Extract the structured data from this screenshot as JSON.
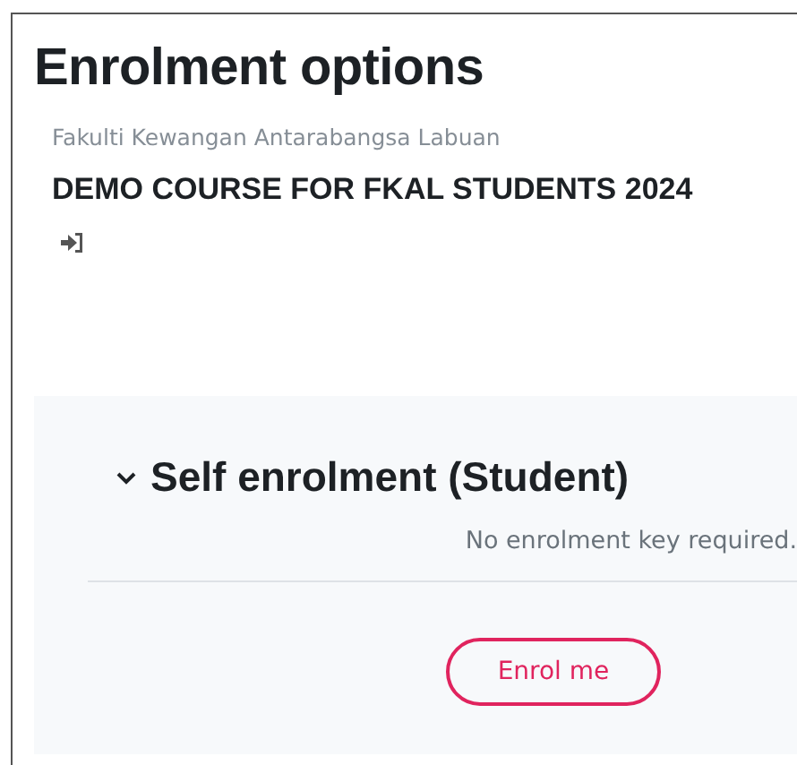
{
  "page": {
    "title": "Enrolment options"
  },
  "course": {
    "category": "Fakulti Kewangan Antarabangsa Labuan",
    "name": "DEMO COURSE FOR FKAL STUDENTS 2024"
  },
  "enrolment_method": {
    "title": "Self enrolment (Student)",
    "expanded": true,
    "note": "No enrolment key required.",
    "button": "Enrol me"
  }
}
